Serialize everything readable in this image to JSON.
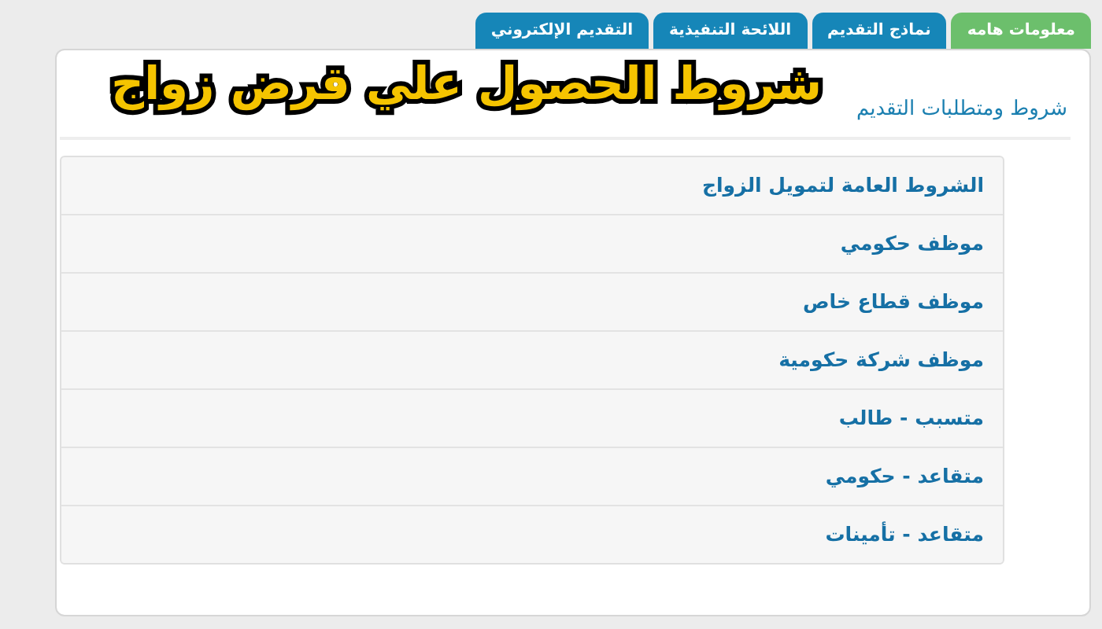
{
  "tabs": [
    {
      "label": "معلومات هامه",
      "selected": true
    },
    {
      "label": "نماذج  التقديم",
      "selected": false
    },
    {
      "label": "اللائحة التنفيذية",
      "selected": false
    },
    {
      "label": "التقديم الإلكتروني",
      "selected": false
    }
  ],
  "overlay_title": "شروط الحصول علي قرض زواج",
  "section": {
    "heading": "شروط ومتطلبات التقديم",
    "items": [
      "الشروط العامة لتمويل الزواج",
      "موظف حكومي",
      "موظف قطاع خاص",
      "موظف شركة حكومية",
      "متسبب - طالب",
      "متقاعد - حكومي",
      "متقاعد - تأمينات"
    ]
  }
}
